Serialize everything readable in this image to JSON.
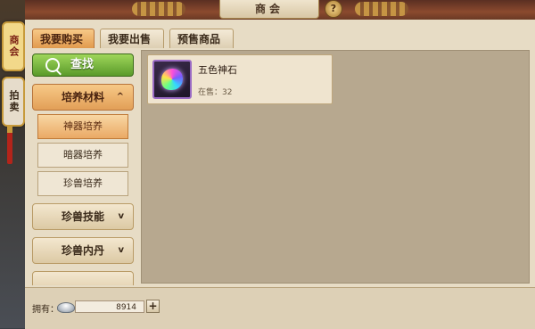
{
  "left_lanterns": [
    "商会",
    "拍卖"
  ],
  "header": {
    "title": "商会",
    "help": "?"
  },
  "tabs": [
    {
      "label": "我要购买",
      "active": true
    },
    {
      "label": "我要出售",
      "active": false
    },
    {
      "label": "预售商品",
      "active": false
    }
  ],
  "menu": {
    "search_label": "查找",
    "categories": [
      {
        "label": "培养材料",
        "chevron": "^",
        "expanded": true,
        "subitems": [
          {
            "label": "神器培养",
            "active": true
          },
          {
            "label": "暗器培养",
            "active": false
          },
          {
            "label": "珍兽培养",
            "active": false
          }
        ]
      },
      {
        "label": "珍兽技能",
        "chevron": "v",
        "expanded": false
      },
      {
        "label": "珍兽内丹",
        "chevron": "v",
        "expanded": false
      }
    ]
  },
  "items": [
    {
      "name": "五色神石",
      "stock": "在售：32",
      "icon": "rainbow-gem-icon"
    }
  ],
  "footer": {
    "own_label": "拥有：",
    "amount": "8914",
    "plus": "+",
    "currency_icon": "silver-ingot-icon"
  },
  "colors": {
    "accent_tab": "#e19a4e",
    "search_green": "#5a9a2a",
    "panel": "#e7dcc5",
    "content_bg": "#b7a88f"
  }
}
